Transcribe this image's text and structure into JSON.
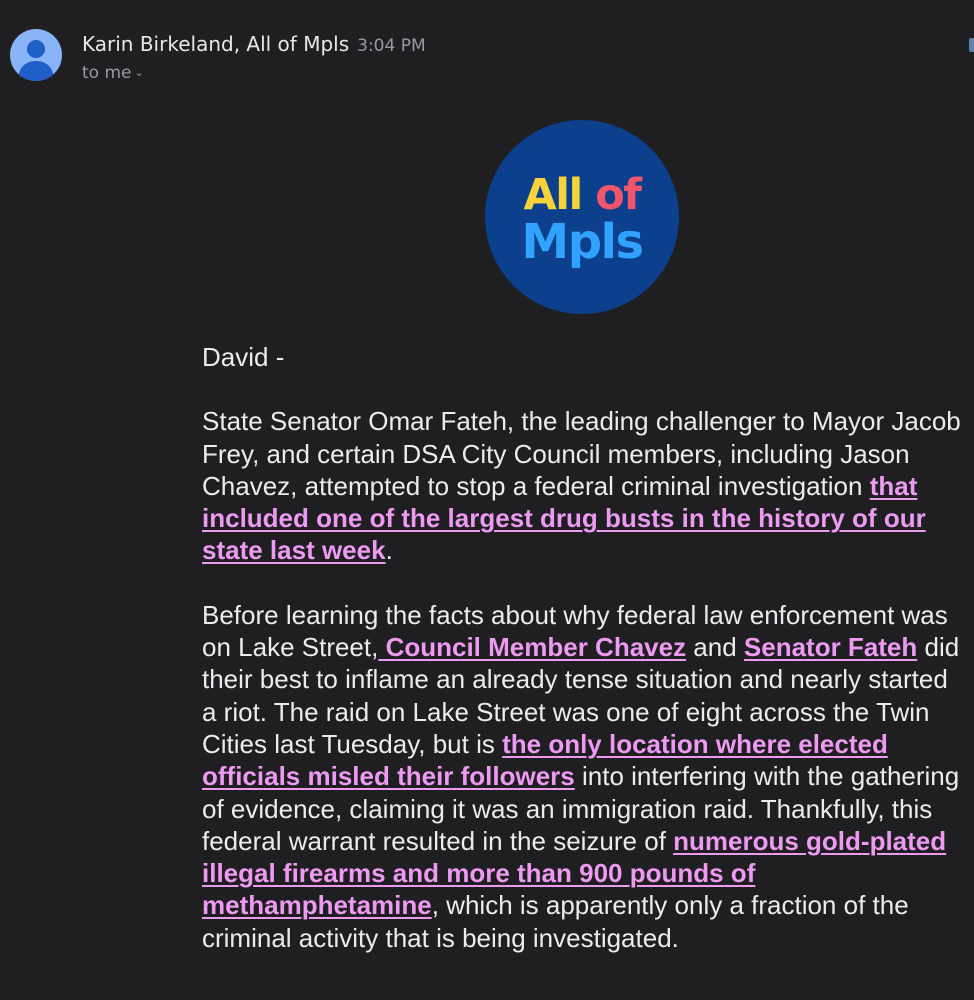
{
  "header": {
    "sender_name": "Karin Birkeland, All of Mpls",
    "time": "3:04 PM",
    "recipient": "to me",
    "avatar_icon": "person-icon",
    "expand_icon": "chevron-down-icon"
  },
  "logo": {
    "word_all": "All",
    "word_of": "of",
    "word_mpls": "Mpls",
    "colors": {
      "background": "#0c3f8c",
      "all": "#f6d33a",
      "of": "#f0556b",
      "mpls": "#31a2ff"
    }
  },
  "email": {
    "greeting": "David -",
    "p1": {
      "text": "State Senator Omar Fateh, the leading challenger to Mayor Jacob Frey, and certain DSA City Council members, including Jason Chavez, attempted to stop a federal criminal investigation ",
      "link": "that included one of the largest drug busts in the history of our state last week",
      "end": "."
    },
    "p2": {
      "t1": "Before learning the facts about why federal law enforcement was on Lake Street,",
      "link1": " Council Member Chavez",
      "t2": " and ",
      "link2": "Senator Fateh",
      "t3": " did their best to inflame an already tense situation and nearly started a riot. The raid on Lake Street was one of eight across the Twin Cities last Tuesday, but is ",
      "link3": "the only location where elected officials misled their followers",
      "t4": " into interfering with the gathering of evidence, claiming it was an immigration raid. Thankfully, this federal warrant resulted in the seizure of ",
      "link4": "numerous gold-plated illegal firearms and more than 900 pounds of methamphetamine",
      "t5": ", which is apparently only a fraction of the criminal activity that is being investigated."
    }
  },
  "colors": {
    "background": "#1f1f22",
    "text": "#ececee",
    "link": "#ee99f2",
    "secondary_text": "#9a9aa0"
  }
}
